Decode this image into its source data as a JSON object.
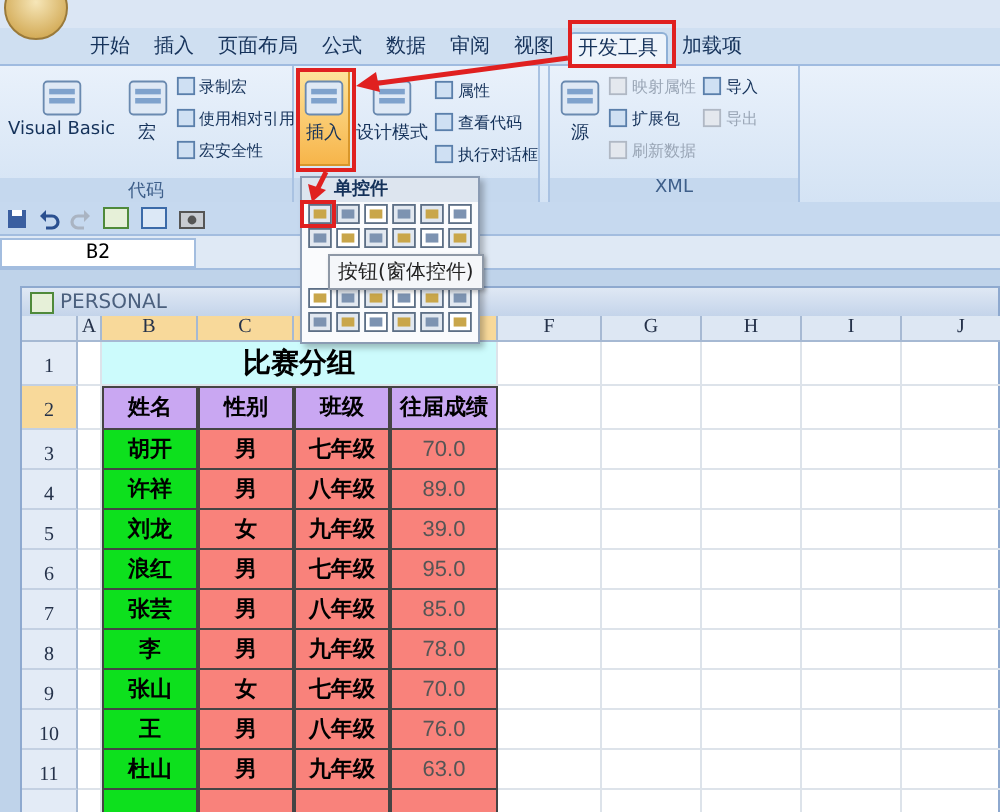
{
  "tabs": [
    {
      "label": "开始",
      "selected": false
    },
    {
      "label": "插入",
      "selected": false
    },
    {
      "label": "页面布局",
      "selected": false
    },
    {
      "label": "公式",
      "selected": false
    },
    {
      "label": "数据",
      "selected": false
    },
    {
      "label": "审阅",
      "selected": false
    },
    {
      "label": "视图",
      "selected": false
    },
    {
      "label": "开发工具",
      "selected": true
    },
    {
      "label": "加载项",
      "selected": false
    }
  ],
  "ribbon": {
    "groups": [
      {
        "label": "代码",
        "items": [
          {
            "label": "Visual Basic",
            "kind": "large",
            "pressed": false,
            "disabled": false
          },
          {
            "label": "宏",
            "kind": "large",
            "pressed": false,
            "disabled": false
          },
          {
            "label": "录制宏",
            "kind": "small",
            "disabled": false
          },
          {
            "label": "使用相对引用",
            "kind": "small",
            "disabled": false
          },
          {
            "label": "宏安全性",
            "kind": "small",
            "disabled": false
          }
        ]
      },
      {
        "items": [
          {
            "label": "插入",
            "kind": "large",
            "pressed": true,
            "disabled": false
          },
          {
            "label": "设计模式",
            "kind": "large",
            "pressed": false,
            "disabled": false
          },
          {
            "label": "属性",
            "kind": "small",
            "disabled": false
          },
          {
            "label": "查看代码",
            "kind": "small",
            "disabled": false
          },
          {
            "label": "执行对话框",
            "kind": "small",
            "disabled": false
          }
        ]
      },
      {
        "label": "XML",
        "items": [
          {
            "label": "源",
            "kind": "large",
            "pressed": false,
            "disabled": false
          },
          {
            "label": "映射属性",
            "kind": "small",
            "disabled": true
          },
          {
            "label": "扩展包",
            "kind": "small",
            "disabled": false
          },
          {
            "label": "刷新数据",
            "kind": "small",
            "disabled": true
          },
          {
            "label": "导入",
            "kind": "small",
            "disabled": false
          },
          {
            "label": "导出",
            "kind": "small",
            "disabled": true
          }
        ]
      }
    ]
  },
  "name_box": {
    "value": "B2"
  },
  "workbook": {
    "title": "PERSONAL"
  },
  "columns_left": [
    "A",
    "B",
    "C"
  ],
  "columns_right": [
    "F",
    "G",
    "H",
    "I",
    "J"
  ],
  "sheet": {
    "title_row": "1",
    "title": "比赛分组",
    "header_row": "2",
    "headers": [
      "姓名",
      "性别",
      "班级",
      "往届成绩"
    ],
    "rows": [
      {
        "row": "3",
        "cells": [
          "胡开",
          "男",
          "七年级",
          "70.0"
        ]
      },
      {
        "row": "4",
        "cells": [
          "许祥",
          "男",
          "八年级",
          "89.0"
        ]
      },
      {
        "row": "5",
        "cells": [
          "刘龙",
          "女",
          "九年级",
          "39.0"
        ]
      },
      {
        "row": "6",
        "cells": [
          "浪红",
          "男",
          "七年级",
          "95.0"
        ]
      },
      {
        "row": "7",
        "cells": [
          "张芸",
          "男",
          "八年级",
          "85.0"
        ]
      },
      {
        "row": "8",
        "cells": [
          "李",
          "男",
          "九年级",
          "78.0"
        ]
      },
      {
        "row": "9",
        "cells": [
          "张山",
          "女",
          "七年级",
          "70.0"
        ]
      },
      {
        "row": "10",
        "cells": [
          "王",
          "男",
          "八年级",
          "76.0"
        ]
      },
      {
        "row": "11",
        "cells": [
          "杜山",
          "男",
          "九年级",
          "63.0"
        ]
      }
    ]
  },
  "dropdown": {
    "header": "单控件",
    "tooltip": "按钮(窗体控件)"
  }
}
